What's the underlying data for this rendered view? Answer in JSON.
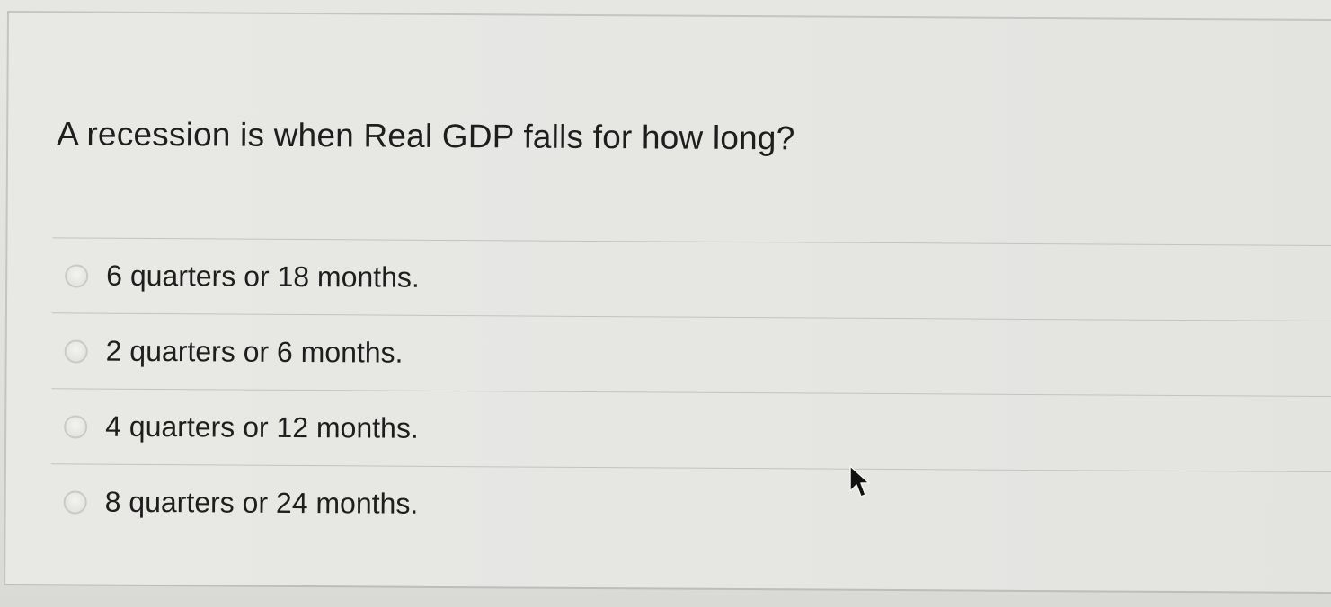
{
  "question": {
    "text": "A recession is when Real GDP falls for how long?"
  },
  "answers": [
    {
      "label": "6 quarters or 18 months.",
      "selected": false
    },
    {
      "label": "2 quarters or 6 months.",
      "selected": false
    },
    {
      "label": "4 quarters or 12 months.",
      "selected": false
    },
    {
      "label": "8 quarters or 24 months.",
      "selected": false
    }
  ],
  "cursor": {
    "icon": "arrow-pointer-icon"
  },
  "colors": {
    "background": "#e6e6e3",
    "text": "#1e1e1e",
    "divider": "#c3c3c0"
  }
}
